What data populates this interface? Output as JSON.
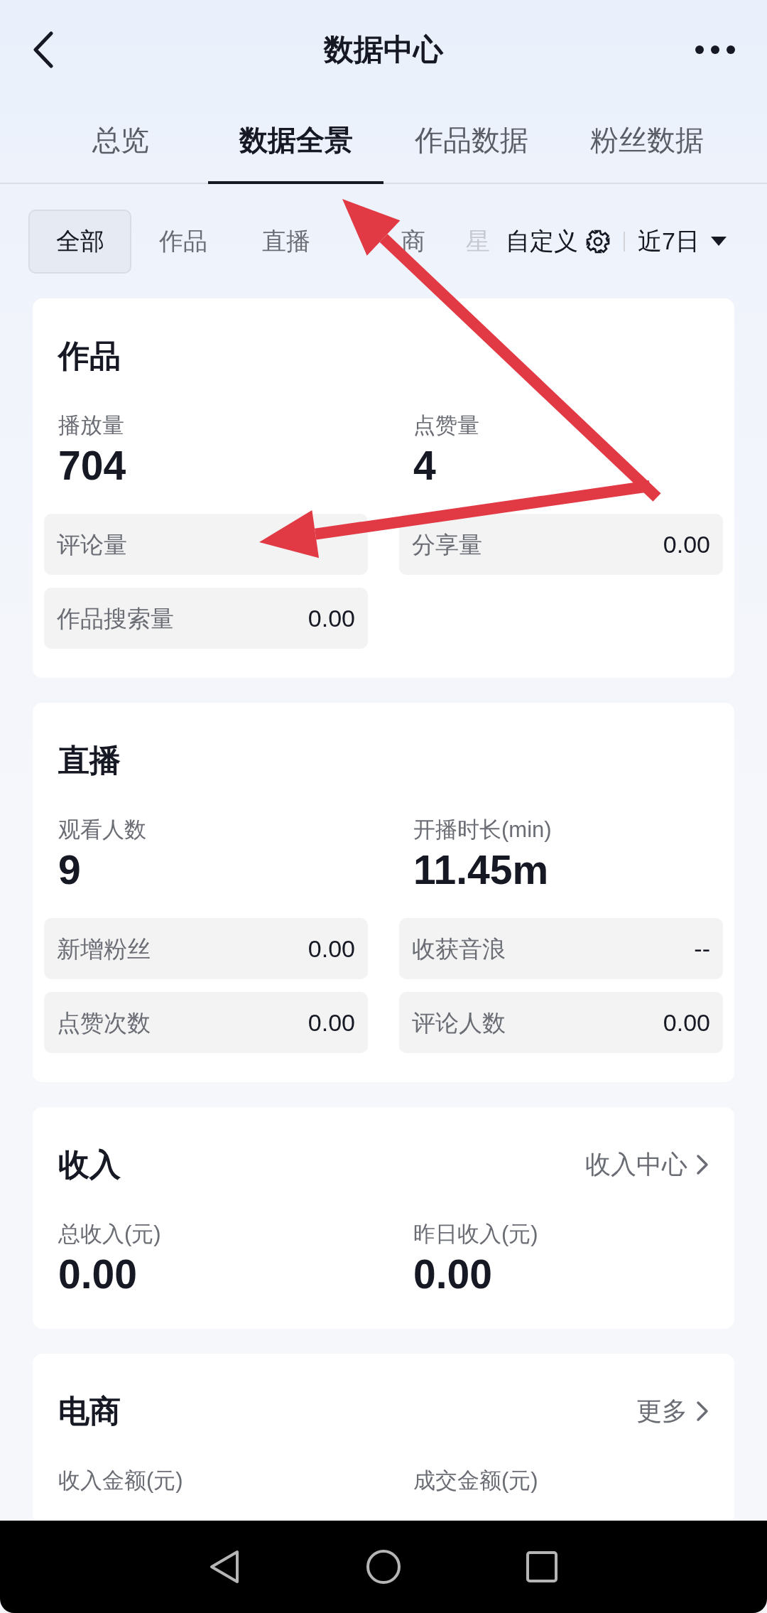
{
  "header": {
    "title": "数据中心"
  },
  "tabs": [
    {
      "label": "总览",
      "selected": false
    },
    {
      "label": "数据全景",
      "selected": true
    },
    {
      "label": "作品数据",
      "selected": false
    },
    {
      "label": "粉丝数据",
      "selected": false
    }
  ],
  "filters": [
    {
      "label": "全部",
      "selected": true
    },
    {
      "label": "作品",
      "selected": false
    },
    {
      "label": "直播",
      "selected": false
    },
    {
      "label": "商",
      "selected": false
    },
    {
      "label": "星",
      "selected": false
    }
  ],
  "customize": "自定义",
  "date_range": "近7日",
  "cards": [
    {
      "title": "作品",
      "metrics": [
        {
          "label": "播放量",
          "value": "704"
        },
        {
          "label": "点赞量",
          "value": "4"
        }
      ],
      "stats": [
        {
          "label": "评论量"
        },
        {
          "label": "分享量",
          "value": "0.00"
        },
        {
          "label": "作品搜索量",
          "value": "0.00"
        }
      ]
    },
    {
      "title": "直播",
      "metrics": [
        {
          "label": "观看人数",
          "value": "9"
        },
        {
          "label": "开播时长(min)",
          "value": "11.45m"
        }
      ],
      "stats": [
        {
          "label": "新增粉丝",
          "value": "0.00"
        },
        {
          "label": "收获音浪",
          "value": "--"
        },
        {
          "label": "点赞次数",
          "value": "0.00"
        },
        {
          "label": "评论人数",
          "value": "0.00"
        }
      ]
    },
    {
      "title": "收入",
      "link": "收入中心",
      "metrics": [
        {
          "label": "总收入(元)",
          "value": "0.00"
        },
        {
          "label": "昨日收入(元)",
          "value": "0.00"
        }
      ]
    },
    {
      "title": "电商",
      "link": "更多",
      "metrics": [
        {
          "label": "收入金额(元)"
        },
        {
          "label": "成交金额(元)"
        }
      ]
    }
  ],
  "annotations": [
    {
      "kind": "arrow"
    },
    {
      "kind": "arrow"
    }
  ]
}
